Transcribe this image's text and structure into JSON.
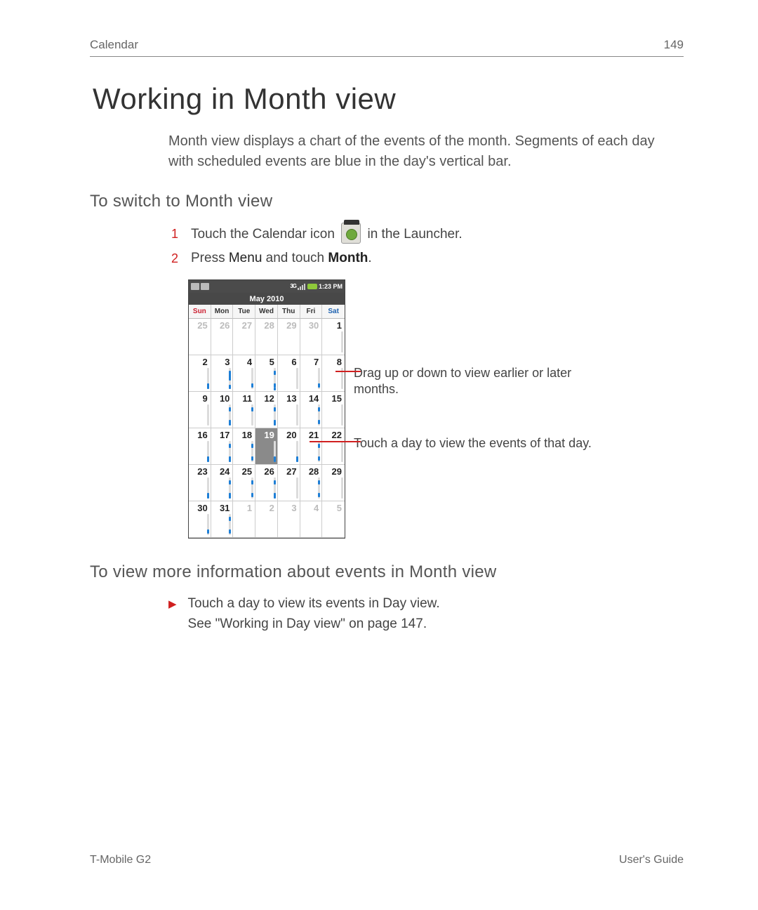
{
  "header": {
    "section": "Calendar",
    "page_number": "149"
  },
  "title": "Working in Month view",
  "intro": "Month view displays a chart of the events of the month. Segments of each day with scheduled events are blue in the day's vertical bar.",
  "subhead_switch": "To switch to Month view",
  "steps": [
    {
      "n": "1",
      "pre": "Touch the Calendar icon ",
      "post": " in the Launcher."
    },
    {
      "n": "2",
      "text_a": "Press ",
      "menu": "Menu",
      "text_b": " and touch ",
      "bold": "Month",
      "text_c": "."
    }
  ],
  "phone": {
    "status_time": "1:23 PM",
    "month_title": "May 2010",
    "day_headers": [
      "Sun",
      "Mon",
      "Tue",
      "Wed",
      "Thu",
      "Fri",
      "Sat"
    ],
    "weeks": [
      [
        {
          "d": "25",
          "dim": true
        },
        {
          "d": "26",
          "dim": true
        },
        {
          "d": "27",
          "dim": true
        },
        {
          "d": "28",
          "dim": true
        },
        {
          "d": "29",
          "dim": true
        },
        {
          "d": "30",
          "dim": true
        },
        {
          "d": "1"
        }
      ],
      [
        {
          "d": "2",
          "ev": [
            [
              40,
              8
            ]
          ]
        },
        {
          "d": "3",
          "ev": [
            [
              22,
              14
            ],
            [
              42,
              6
            ]
          ]
        },
        {
          "d": "4",
          "ev": [
            [
              40,
              6
            ]
          ]
        },
        {
          "d": "5",
          "ev": [
            [
              22,
              6
            ],
            [
              40,
              6
            ],
            [
              46,
              4
            ]
          ]
        },
        {
          "d": "6"
        },
        {
          "d": "7",
          "ev": [
            [
              40,
              6
            ]
          ]
        },
        {
          "d": "8"
        }
      ],
      [
        {
          "d": "9"
        },
        {
          "d": "10",
          "ev": [
            [
              22,
              6
            ],
            [
              40,
              8
            ]
          ]
        },
        {
          "d": "11",
          "ev": [
            [
              22,
              6
            ]
          ]
        },
        {
          "d": "12",
          "ev": [
            [
              22,
              6
            ],
            [
              40,
              8
            ]
          ]
        },
        {
          "d": "13"
        },
        {
          "d": "14",
          "ev": [
            [
              22,
              6
            ],
            [
              40,
              6
            ]
          ]
        },
        {
          "d": "15"
        }
      ],
      [
        {
          "d": "16",
          "ev": [
            [
              40,
              8
            ]
          ]
        },
        {
          "d": "17",
          "ev": [
            [
              22,
              6
            ],
            [
              40,
              8
            ]
          ]
        },
        {
          "d": "18",
          "ev": [
            [
              22,
              6
            ],
            [
              40,
              6
            ]
          ]
        },
        {
          "d": "19",
          "sel": true,
          "ev": [
            [
              40,
              8
            ]
          ]
        },
        {
          "d": "20",
          "ev": [
            [
              40,
              8
            ]
          ]
        },
        {
          "d": "21",
          "ev": [
            [
              22,
              6
            ],
            [
              40,
              6
            ]
          ]
        },
        {
          "d": "22"
        }
      ],
      [
        {
          "d": "23",
          "ev": [
            [
              40,
              8
            ]
          ]
        },
        {
          "d": "24",
          "ev": [
            [
              22,
              6
            ],
            [
              40,
              8
            ]
          ]
        },
        {
          "d": "25",
          "ev": [
            [
              22,
              6
            ],
            [
              40,
              6
            ]
          ]
        },
        {
          "d": "26",
          "ev": [
            [
              22,
              6
            ],
            [
              40,
              8
            ]
          ]
        },
        {
          "d": "27"
        },
        {
          "d": "28",
          "ev": [
            [
              22,
              6
            ],
            [
              40,
              6
            ]
          ]
        },
        {
          "d": "29"
        }
      ],
      [
        {
          "d": "30",
          "ev": [
            [
              40,
              6
            ]
          ]
        },
        {
          "d": "31",
          "ev": [
            [
              22,
              6
            ],
            [
              40,
              6
            ]
          ]
        },
        {
          "d": "1",
          "dim": true
        },
        {
          "d": "2",
          "dim": true
        },
        {
          "d": "3",
          "dim": true
        },
        {
          "d": "4",
          "dim": true
        },
        {
          "d": "5",
          "dim": true
        }
      ]
    ]
  },
  "callouts": {
    "drag": "Drag up or down to view earlier or later months.",
    "touch": "Touch a day to view the events of that day."
  },
  "subhead_info": "To view more information about events in Month view",
  "bullet": {
    "line1": "Touch a day to view its events in Day view.",
    "line2": "See \"Working in Day view\" on page 147."
  },
  "footer": {
    "left": "T-Mobile G2",
    "right": "User's Guide"
  }
}
